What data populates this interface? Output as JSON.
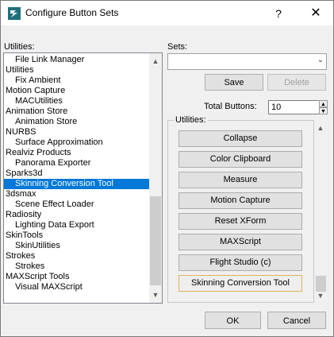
{
  "window": {
    "title": "Configure Button Sets",
    "help_glyph": "?",
    "close_glyph": "✕"
  },
  "utilities_label": "Utilities:",
  "utilities_list": [
    {
      "label": "File Link Manager",
      "child": true,
      "selected": false
    },
    {
      "label": "Utilities",
      "child": false,
      "selected": false
    },
    {
      "label": "Fix Ambient",
      "child": true,
      "selected": false
    },
    {
      "label": "Motion Capture",
      "child": false,
      "selected": false
    },
    {
      "label": "MACUtilities",
      "child": true,
      "selected": false
    },
    {
      "label": "Animation Store",
      "child": false,
      "selected": false
    },
    {
      "label": "Animation Store",
      "child": true,
      "selected": false
    },
    {
      "label": "NURBS",
      "child": false,
      "selected": false
    },
    {
      "label": "Surface Approximation",
      "child": true,
      "selected": false
    },
    {
      "label": "Realviz Products",
      "child": false,
      "selected": false
    },
    {
      "label": "Panorama Exporter",
      "child": true,
      "selected": false
    },
    {
      "label": "Sparks3d",
      "child": false,
      "selected": false
    },
    {
      "label": "Skinning Conversion Tool",
      "child": true,
      "selected": true
    },
    {
      "label": "3dsmax",
      "child": false,
      "selected": false
    },
    {
      "label": "Scene Effect Loader",
      "child": true,
      "selected": false
    },
    {
      "label": "Radiosity",
      "child": false,
      "selected": false
    },
    {
      "label": "Lighting Data Export",
      "child": true,
      "selected": false
    },
    {
      "label": "SkinTools",
      "child": false,
      "selected": false
    },
    {
      "label": "SkinUtilities",
      "child": true,
      "selected": false
    },
    {
      "label": "Strokes",
      "child": false,
      "selected": false
    },
    {
      "label": "Strokes",
      "child": true,
      "selected": false
    },
    {
      "label": "MAXScript Tools",
      "child": false,
      "selected": false
    },
    {
      "label": "Visual MAXScript",
      "child": true,
      "selected": false
    }
  ],
  "sets": {
    "label": "Sets:",
    "value": "",
    "save_label": "Save",
    "delete_label": "Delete"
  },
  "total_buttons": {
    "label": "Total Buttons:",
    "value": "10"
  },
  "group": {
    "label": "Utilities:",
    "buttons": [
      "Collapse",
      "Color Clipboard",
      "Measure",
      "Motion Capture",
      "Reset XForm",
      "MAXScript",
      "Flight Studio (c)",
      "Skinning Conversion Tool"
    ]
  },
  "footer": {
    "ok_label": "OK",
    "cancel_label": "Cancel"
  },
  "colors": {
    "selection": "#0078d7",
    "accent_border": "#e0b35c"
  }
}
